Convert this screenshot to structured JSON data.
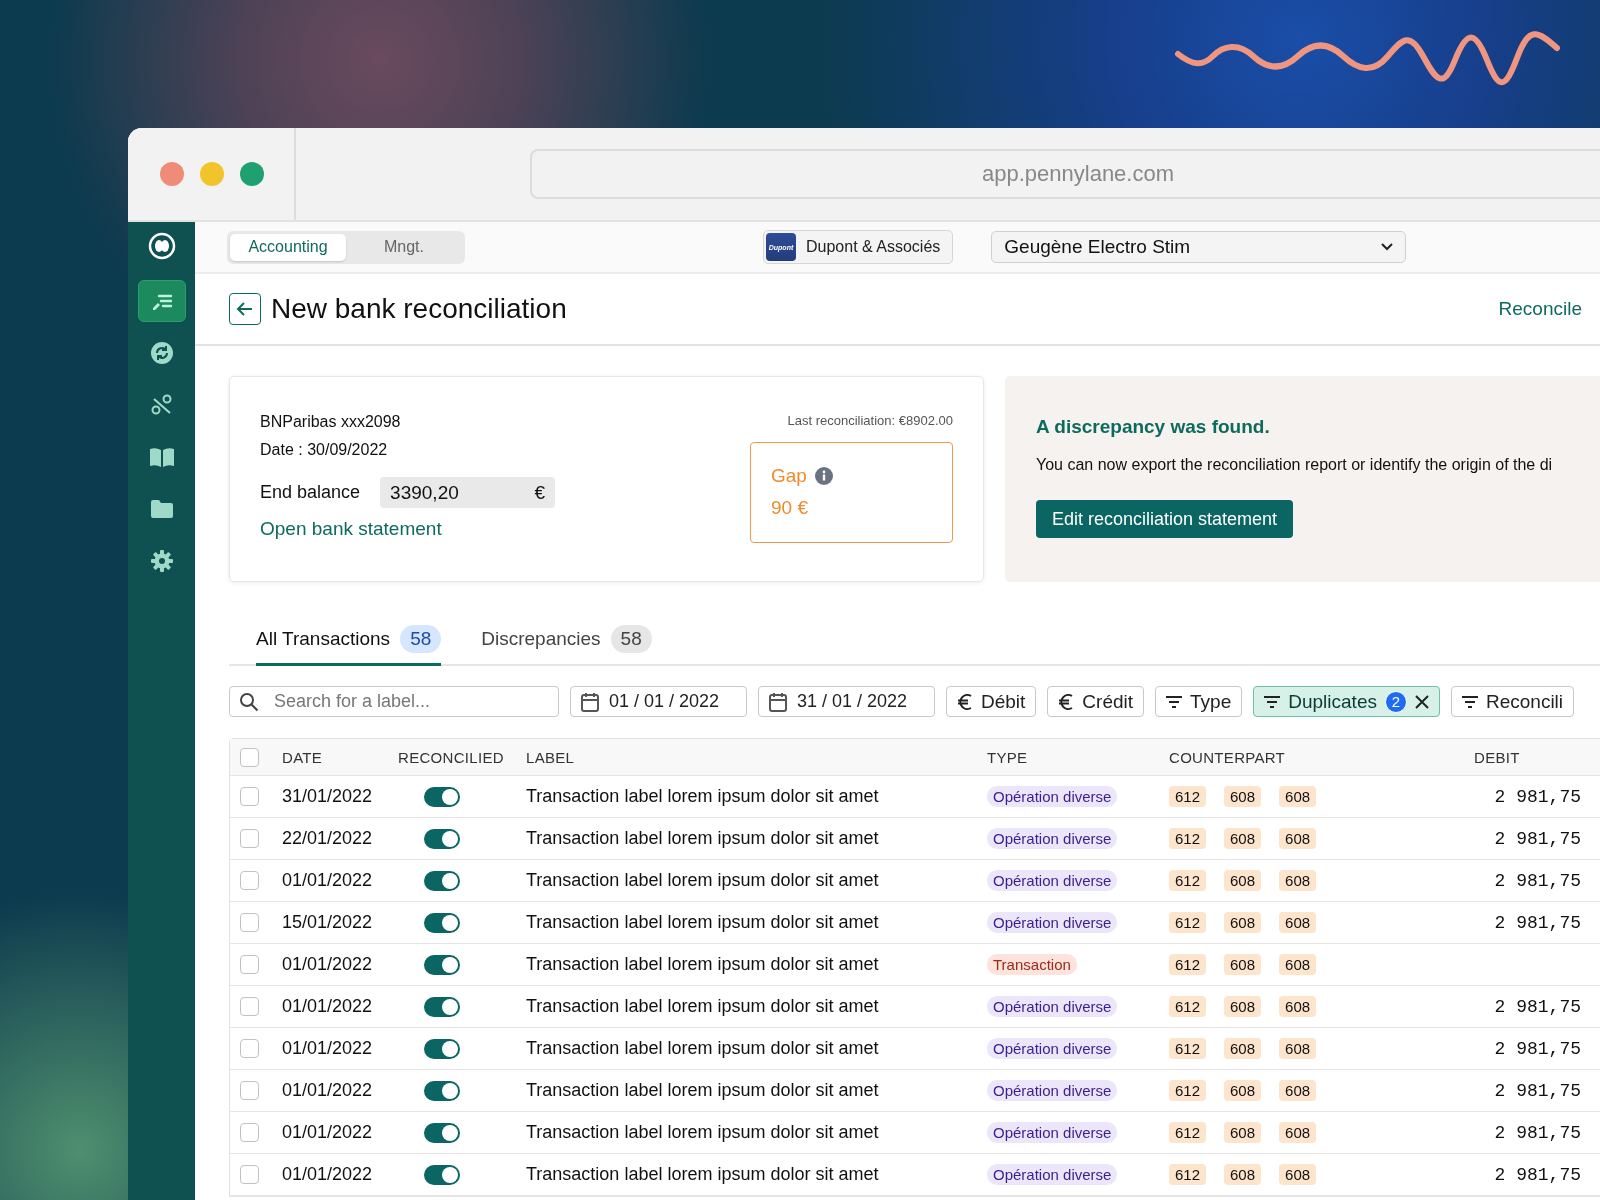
{
  "browser": {
    "url": "app.pennylane.com"
  },
  "sidebar": {
    "items": [
      {
        "kind": "edit",
        "selected": true
      },
      {
        "kind": "sync",
        "selected": false
      },
      {
        "kind": "percent",
        "selected": false
      },
      {
        "kind": "book",
        "selected": false
      },
      {
        "kind": "folder",
        "selected": false
      },
      {
        "kind": "settings",
        "selected": false
      }
    ]
  },
  "topbar": {
    "modes": [
      {
        "label": "Accounting",
        "selected": true
      },
      {
        "label": "Mngt.",
        "selected": false
      }
    ],
    "firm": {
      "logo_text": "Dupont",
      "name": "Dupont & Associés"
    },
    "company_select": {
      "value": "Geugène Electro Stim"
    }
  },
  "header": {
    "title": "New bank reconciliation",
    "action": "Reconcile"
  },
  "statement": {
    "account": "BNParibas xxx2098",
    "date": "Date : 30/09/2022",
    "end_balance_label": "End balance",
    "end_balance": "3390,20",
    "currency": "€",
    "link": "Open bank statement",
    "last_reconciliation": "Last reconciliation: €8902.00",
    "gap_label": "Gap",
    "gap_value": "90 €"
  },
  "discrepancy": {
    "title": "A discrepancy was found.",
    "text": "You can now export the reconciliation report or identify the origin of the di",
    "button": "Edit reconciliation statement"
  },
  "tabs": [
    {
      "label": "All Transactions",
      "count": "58",
      "selected": true
    },
    {
      "label": "Discrepancies",
      "count": "58",
      "selected": false
    }
  ],
  "filters": {
    "search_placeholder": "Search for a label...",
    "date_from": "01 / 01 / 2022",
    "date_to": "31 / 01 / 2022",
    "chips": [
      {
        "kind": "amount",
        "label": "Débit",
        "active": false
      },
      {
        "kind": "amount",
        "label": "Crédit",
        "active": false
      },
      {
        "kind": "filter",
        "label": "Type",
        "active": false
      },
      {
        "kind": "filter",
        "label": "Duplicates",
        "count": "2",
        "active": true
      },
      {
        "kind": "filter",
        "label": "Reconcili",
        "active": false
      }
    ]
  },
  "table": {
    "columns": [
      "DATE",
      "RECONCILIED",
      "LABEL",
      "TYPE",
      "COUNTERPART",
      "DEBIT"
    ],
    "header_checked": false,
    "rows": [
      {
        "checked": false,
        "date": "31/01/2022",
        "reconciled": true,
        "label": "Transaction label lorem ipsum dolor sit amet",
        "type": {
          "kind": "misc",
          "label": "Opération diverse"
        },
        "counterpart": [
          "612",
          "608",
          "608"
        ],
        "debit": "2 981,75"
      },
      {
        "checked": false,
        "date": "22/01/2022",
        "reconciled": true,
        "label": "Transaction label lorem ipsum dolor sit amet",
        "type": {
          "kind": "misc",
          "label": "Opération diverse"
        },
        "counterpart": [
          "612",
          "608",
          "608"
        ],
        "debit": "2 981,75"
      },
      {
        "checked": false,
        "date": "01/01/2022",
        "reconciled": true,
        "label": "Transaction label lorem ipsum dolor sit amet",
        "type": {
          "kind": "misc",
          "label": "Opération diverse"
        },
        "counterpart": [
          "612",
          "608",
          "608"
        ],
        "debit": "2 981,75"
      },
      {
        "checked": false,
        "date": "15/01/2022",
        "reconciled": true,
        "label": "Transaction label lorem ipsum dolor sit amet",
        "type": {
          "kind": "misc",
          "label": "Opération diverse"
        },
        "counterpart": [
          "612",
          "608",
          "608"
        ],
        "debit": "2 981,75"
      },
      {
        "checked": false,
        "date": "01/01/2022",
        "reconciled": true,
        "label": "Transaction label lorem ipsum dolor sit amet",
        "type": {
          "kind": "transaction",
          "label": "Transaction"
        },
        "counterpart": [
          "612",
          "608",
          "608"
        ]
      },
      {
        "checked": false,
        "date": "01/01/2022",
        "reconciled": true,
        "label": "Transaction label lorem ipsum dolor sit amet",
        "type": {
          "kind": "misc",
          "label": "Opération diverse"
        },
        "counterpart": [
          "612",
          "608",
          "608"
        ],
        "debit": "2 981,75"
      },
      {
        "checked": false,
        "date": "01/01/2022",
        "reconciled": true,
        "label": "Transaction label lorem ipsum dolor sit amet",
        "type": {
          "kind": "misc",
          "label": "Opération diverse"
        },
        "counterpart": [
          "612",
          "608",
          "608"
        ],
        "debit": "2 981,75"
      },
      {
        "checked": false,
        "date": "01/01/2022",
        "reconciled": true,
        "label": "Transaction label lorem ipsum dolor sit amet",
        "type": {
          "kind": "misc",
          "label": "Opération diverse"
        },
        "counterpart": [
          "612",
          "608",
          "608"
        ],
        "debit": "2 981,75"
      },
      {
        "checked": false,
        "date": "01/01/2022",
        "reconciled": true,
        "label": "Transaction label lorem ipsum dolor sit amet",
        "type": {
          "kind": "misc",
          "label": "Opération diverse"
        },
        "counterpart": [
          "612",
          "608",
          "608"
        ],
        "debit": "2 981,75"
      },
      {
        "checked": false,
        "date": "01/01/2022",
        "reconciled": true,
        "label": "Transaction label lorem ipsum dolor sit amet",
        "type": {
          "kind": "misc",
          "label": "Opération diverse"
        },
        "counterpart": [
          "612",
          "608",
          "608"
        ],
        "debit": "2 981,75"
      }
    ]
  }
}
